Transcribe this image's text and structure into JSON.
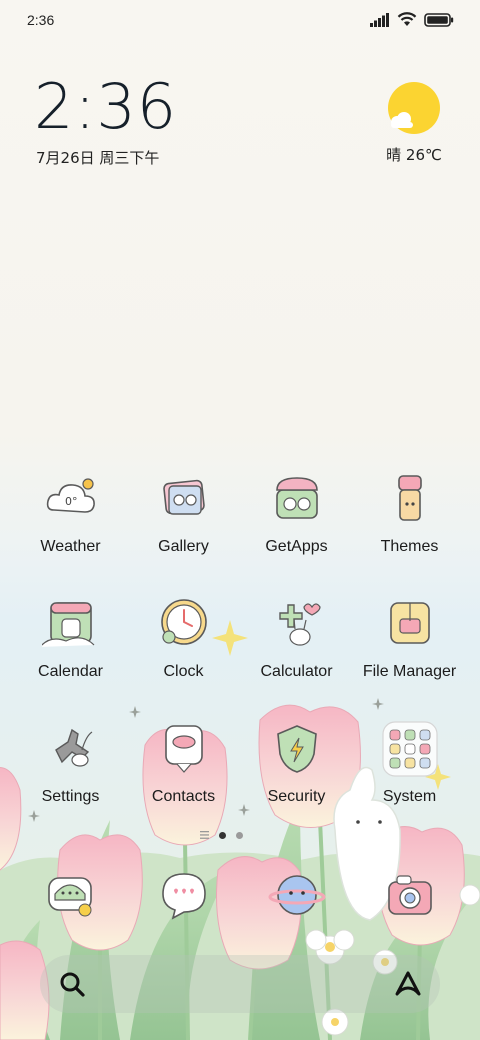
{
  "status_bar": {
    "time": "2:36",
    "icons": [
      "signal-icon",
      "wifi-icon",
      "battery-icon"
    ]
  },
  "clock_widget": {
    "time": "2:36",
    "date": "7月26日 周三下午"
  },
  "weather_widget": {
    "text": "晴 26℃",
    "icon": "sun-cloud-icon"
  },
  "apps": [
    {
      "label": "Weather",
      "icon": "cloud-icon"
    },
    {
      "label": "Gallery",
      "icon": "photos-icon"
    },
    {
      "label": "GetApps",
      "icon": "store-icon"
    },
    {
      "label": "Themes",
      "icon": "brush-icon"
    },
    {
      "label": "Calendar",
      "icon": "calendar-icon"
    },
    {
      "label": "Clock",
      "icon": "clock-icon"
    },
    {
      "label": "Calculator",
      "icon": "calculator-icon"
    },
    {
      "label": "File Manager",
      "icon": "folder-icon"
    },
    {
      "label": "Settings",
      "icon": "gear-icon"
    },
    {
      "label": "Contacts",
      "icon": "contacts-icon"
    },
    {
      "label": "Security",
      "icon": "shield-icon"
    },
    {
      "label": "System",
      "icon": "app-folder-icon"
    }
  ],
  "page_indicator": {
    "pages": 2,
    "current": 1
  },
  "dock": [
    {
      "icon": "phone-icon"
    },
    {
      "icon": "messages-icon"
    },
    {
      "icon": "browser-icon"
    },
    {
      "icon": "camera-icon"
    }
  ],
  "search_bar": {
    "left_icon": "search-icon",
    "right_icon": "assistant-icon"
  },
  "colors": {
    "sun": "#fbd431",
    "tulip_pink": "#f4b8c4",
    "tulip_cream": "#fbf1dc",
    "stem_green": "#a9cfa2",
    "sky": "#e4f0f5"
  }
}
